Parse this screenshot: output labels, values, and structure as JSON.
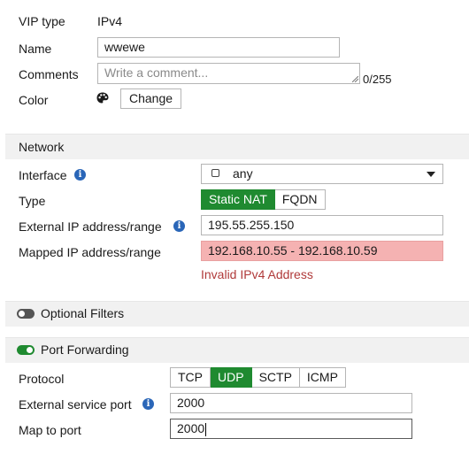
{
  "general": {
    "vip_type_label": "VIP type",
    "vip_type_value": "IPv4",
    "name_label": "Name",
    "name_value": "wwewe",
    "comments_label": "Comments",
    "comments_placeholder": "Write a comment...",
    "comments_counter": "0/255",
    "color_label": "Color",
    "color_change_button": "Change"
  },
  "network": {
    "section_title": "Network",
    "interface_label": "Interface",
    "interface_value": "any",
    "type_label": "Type",
    "type_options": [
      "Static NAT",
      "FQDN"
    ],
    "type_selected": "Static NAT",
    "external_ip_label": "External IP address/range",
    "external_ip_value": "195.55.255.150",
    "mapped_ip_label": "Mapped IP address/range",
    "mapped_ip_value": "192.168.10.55 - 192.168.10.59",
    "mapped_ip_error": "Invalid IPv4 Address"
  },
  "optional_filters": {
    "label": "Optional Filters",
    "enabled": false
  },
  "port_forwarding": {
    "label": "Port Forwarding",
    "enabled": true,
    "protocol_label": "Protocol",
    "protocol_options": [
      "TCP",
      "UDP",
      "SCTP",
      "ICMP"
    ],
    "protocol_selected": "UDP",
    "external_port_label": "External service port",
    "external_port_value": "2000",
    "map_to_port_label": "Map to port",
    "map_to_port_value": "2000"
  },
  "colors": {
    "accent_green": "#1f8a30",
    "error_bg": "#f5b2b2",
    "error_text": "#b03a3a",
    "info_blue": "#2a66b8"
  }
}
